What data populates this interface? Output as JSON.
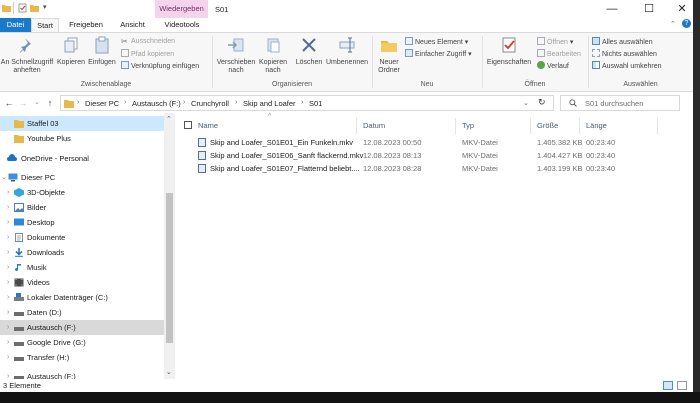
{
  "window": {
    "title": "S01",
    "context_tab": "Wiedergeben",
    "controls": {
      "minimize": "—",
      "maximize": "☐",
      "close": "✕"
    }
  },
  "ribbon_tabs": {
    "file": "Datei",
    "start": "Start",
    "share": "Freigeben",
    "view": "Ansicht",
    "video_tools": "Videotools"
  },
  "ribbon": {
    "clipboard": {
      "label": "Zwischenablage",
      "pin_l1": "An Schnellzugriff",
      "pin_l2": "anheften",
      "copy": "Kopieren",
      "paste": "Einfügen",
      "cut": "Ausschneiden",
      "copy_path": "Pfad kopieren",
      "paste_shortcut": "Verknüpfung einfügen"
    },
    "organize": {
      "label": "Organisieren",
      "move_l1": "Verschieben",
      "move_l2": "nach",
      "copyto_l1": "Kopieren",
      "copyto_l2": "nach",
      "delete": "Löschen",
      "rename": "Umbenennen"
    },
    "new": {
      "label": "Neu",
      "folder_l1": "Neuer",
      "folder_l2": "Ordner",
      "new_item": "Neues Element",
      "easy_access": "Einfacher Zugriff"
    },
    "open": {
      "label": "Öffnen",
      "properties": "Eigenschaften",
      "open": "Öffnen",
      "edit": "Bearbeiten",
      "history": "Verlauf"
    },
    "select": {
      "label": "Auswählen",
      "select_all": "Alles auswählen",
      "select_none": "Nichts auswählen",
      "invert": "Auswahl umkehren"
    }
  },
  "address": {
    "crumbs": [
      "Dieser PC",
      "Austausch (F:)",
      "Crunchyroll",
      "Skip and Loafer",
      "S01"
    ],
    "search_placeholder": "S01 durchsuchen",
    "separator": "›"
  },
  "nav": {
    "items": [
      {
        "label": "Staffel 03",
        "icon": "folder-icon",
        "selected": true
      },
      {
        "label": "Youtube Plus",
        "icon": "folder-icon"
      },
      {
        "label": "OneDrive - Personal",
        "icon": "cloud-icon"
      },
      {
        "label": "Dieser PC",
        "icon": "computer-icon"
      },
      {
        "label": "3D-Objekte",
        "icon": "cube-icon"
      },
      {
        "label": "Bilder",
        "icon": "pictures-icon"
      },
      {
        "label": "Desktop",
        "icon": "desktop-icon"
      },
      {
        "label": "Dokumente",
        "icon": "documents-icon"
      },
      {
        "label": "Downloads",
        "icon": "download-icon"
      },
      {
        "label": "Musik",
        "icon": "music-icon"
      },
      {
        "label": "Videos",
        "icon": "video-icon"
      },
      {
        "label": "Lokaler Datenträger (C:)",
        "icon": "drive-icon"
      },
      {
        "label": "Daten (D:)",
        "icon": "drive-icon"
      },
      {
        "label": "Austausch (F:)",
        "icon": "drive-icon",
        "hover": true
      },
      {
        "label": "Google Drive (G:)",
        "icon": "drive-icon"
      },
      {
        "label": "Transfer (H:)",
        "icon": "drive-icon"
      },
      {
        "label": "Austausch (F:)",
        "icon": "drive-icon"
      }
    ]
  },
  "columns": {
    "name": "Name",
    "date": "Datum",
    "type": "Typ",
    "size": "Größe",
    "length": "Länge"
  },
  "files": [
    {
      "name": "Skip and Loafer_S01E01_Ein Funkeln.mkv",
      "date": "12.08.2023 00:50",
      "type": "MKV-Datei",
      "size": "1.405.382 KB",
      "length": "00:23:40"
    },
    {
      "name": "Skip and Loafer_S01E06_Sanft flackernd.mkv",
      "date": "12.08.2023 08:13",
      "type": "MKV-Datei",
      "size": "1.404.427 KB",
      "length": "00:23:40"
    },
    {
      "name": "Skip and Loafer_S01E07_Flatternd beliebt....",
      "date": "12.08.2023 08:28",
      "type": "MKV-Datei",
      "size": "1.403.199 KB",
      "length": "00:23:40"
    }
  ],
  "status": {
    "count": "3 Elemente"
  },
  "colors": {
    "accent": "#1979ca",
    "context_tab_bg": "#f3d4ec",
    "selection": "#cce8ff"
  }
}
